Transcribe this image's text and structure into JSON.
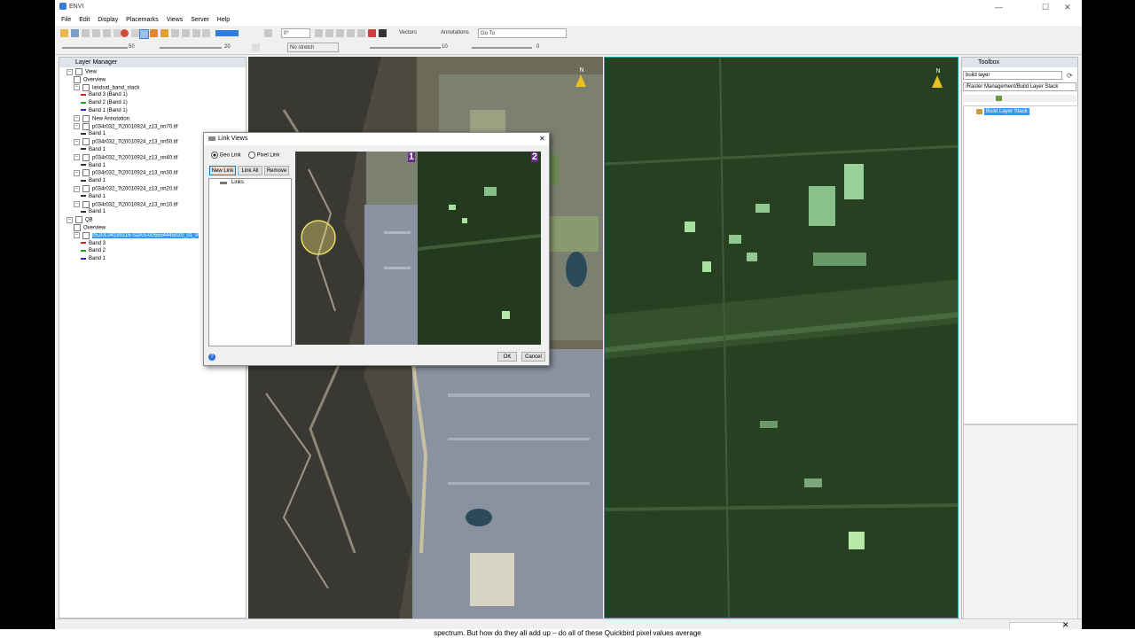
{
  "window": {
    "title": "ENVI",
    "minimize": "—",
    "maximize": "☐",
    "close": "✕"
  },
  "menu": [
    "File",
    "Edit",
    "Display",
    "Placemarks",
    "Views",
    "Server",
    "Help"
  ],
  "toolbar": {
    "rotation_value": "0°",
    "vectors_label": "Vectors",
    "annotations_label": "Annotations",
    "goto_value": "Go To",
    "brightness_value": "50",
    "contrast_value": "20",
    "stretch_value": "No stretch",
    "sharpen_value": "10",
    "transparency_value": "0"
  },
  "layer_manager": {
    "title": "Layer Manager",
    "rows": [
      {
        "text": "View",
        "level": 0,
        "type": "view"
      },
      {
        "text": "Overview",
        "level": 1,
        "type": "cb"
      },
      {
        "text": "landsat_band_stack",
        "level": 1,
        "type": "layer"
      },
      {
        "text": "Band 3 (Band 1)",
        "level": 2,
        "type": "band",
        "color": "#e02020"
      },
      {
        "text": "Band 2 (Band 1)",
        "level": 2,
        "type": "band",
        "color": "#20a020"
      },
      {
        "text": "Band 1 (Band 1)",
        "level": 2,
        "type": "band",
        "color": "#2030d0"
      },
      {
        "text": "New Annotation",
        "level": 1,
        "type": "layer"
      },
      {
        "text": "p034r032_7t20010924_z13_nn70.tif",
        "level": 1,
        "type": "layer"
      },
      {
        "text": "Band 1",
        "level": 2,
        "type": "band",
        "color": "#333333"
      },
      {
        "text": "p034r032_7t20010924_z13_nn50.tif",
        "level": 1,
        "type": "layer"
      },
      {
        "text": "Band 1",
        "level": 2,
        "type": "band",
        "color": "#333333"
      },
      {
        "text": "p034r032_7t20010924_z13_nn40.tif",
        "level": 1,
        "type": "layer"
      },
      {
        "text": "Band 1",
        "level": 2,
        "type": "band",
        "color": "#333333"
      },
      {
        "text": "p034r032_7t20010924_z13_nn30.tif",
        "level": 1,
        "type": "layer"
      },
      {
        "text": "Band 1",
        "level": 2,
        "type": "band",
        "color": "#333333"
      },
      {
        "text": "p034r032_7t20010924_z13_nn20.tif",
        "level": 1,
        "type": "layer"
      },
      {
        "text": "Band 1",
        "level": 2,
        "type": "band",
        "color": "#333333"
      },
      {
        "text": "p034r032_7t20010924_z13_nn10.tif",
        "level": 1,
        "type": "layer"
      },
      {
        "text": "Band 1",
        "level": 2,
        "type": "band",
        "color": "#333333"
      },
      {
        "text": "QB",
        "level": 0,
        "type": "view"
      },
      {
        "text": "Overview",
        "level": 1,
        "type": "cb"
      },
      {
        "text": "05JUL04180116-S2AS-005554445020_01_P",
        "level": 1,
        "type": "selected"
      },
      {
        "text": "Band 3",
        "level": 2,
        "type": "band",
        "color": "#e02020"
      },
      {
        "text": "Band 2",
        "level": 2,
        "type": "band",
        "color": "#20a020"
      },
      {
        "text": "Band 1",
        "level": 2,
        "type": "band",
        "color": "#2030d0"
      }
    ]
  },
  "toolbox": {
    "title": "Toolbox",
    "search_value": "build layer",
    "path": "/Raster Management/Build Layer Stack",
    "result": "Build Layer Stack"
  },
  "dialog": {
    "title": "Link Views",
    "geo_link": "Geo Link",
    "pixel_link": "Pixel Link",
    "new_link": "New Link",
    "link_all": "Link All",
    "remove": "Remove",
    "links_label": "Links",
    "view1": "1",
    "view2": "2",
    "ok": "OK",
    "cancel": "Cancel",
    "close": "✕",
    "help": "?"
  },
  "north": "N",
  "caption": "spectrum. But how do they all add up – do all of these Quickbird pixel values average"
}
